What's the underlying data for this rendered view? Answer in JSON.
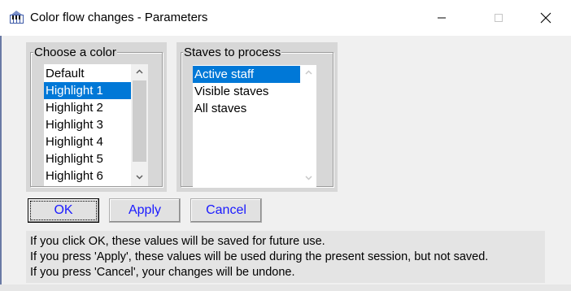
{
  "window": {
    "title": "Color flow changes - Parameters",
    "icon": "piano-keys-icon",
    "controls": [
      "minimize-icon",
      "maximize-icon",
      "close-icon"
    ]
  },
  "color_group": {
    "label": "Choose a color",
    "items": [
      "Default",
      "Highlight 1",
      "Highlight 2",
      "Highlight 3",
      "Highlight 4",
      "Highlight 5",
      "Highlight 6"
    ],
    "selected": "Highlight 1"
  },
  "staves_group": {
    "label": "Staves to process",
    "items": [
      "Active staff",
      "Visible staves",
      "All staves"
    ],
    "selected": "Active staff"
  },
  "buttons": {
    "ok": "OK",
    "apply": "Apply",
    "cancel": "Cancel"
  },
  "info": {
    "line1": "If you click OK, these values will be saved for future use.",
    "line2": "If you press 'Apply', these values will be used during the present session, but not saved.",
    "line3": "If you press 'Cancel', your changes will be undone."
  },
  "colors": {
    "selection": "#0078d7",
    "button_text": "#1a1aff",
    "group_background": "#d7d7d7"
  }
}
